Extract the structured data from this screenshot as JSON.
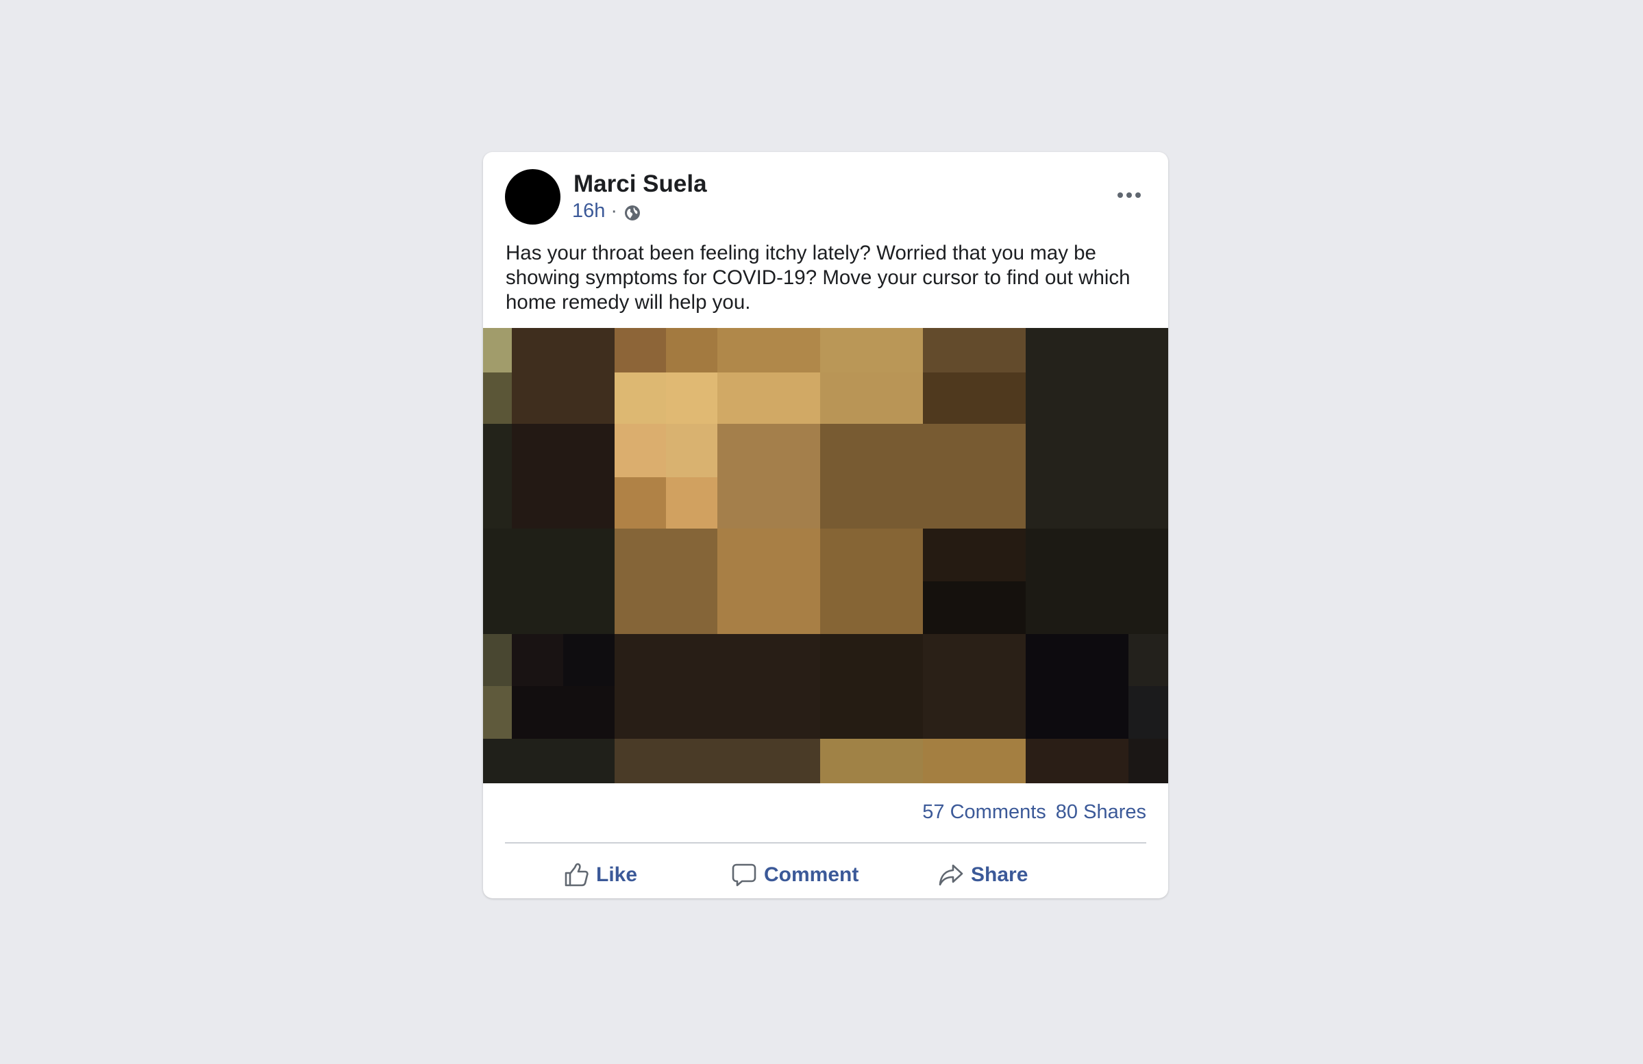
{
  "post": {
    "author": "Marci Suela",
    "time": "16h",
    "separator": "·",
    "privacy_icon": "globe-icon",
    "more_icon": "more-options-icon",
    "text": "Has your throat been feeling itchy lately? Worried that you may be showing symptoms for COVID-19? Move your cursor to find out which home remedy will help you.",
    "image": {
      "description": "pixelated-image",
      "palette": {
        "tan": "#c9a45f",
        "dark": "#23201a",
        "brown": "#78592f"
      }
    },
    "stats": {
      "comments": "57 Comments",
      "shares": "80 Shares"
    },
    "actions": {
      "like": "Like",
      "comment": "Comment",
      "share": "Share"
    }
  },
  "colors": {
    "background": "#e9eaee",
    "link_blue": "#3b5998",
    "text": "#1c1e21"
  }
}
